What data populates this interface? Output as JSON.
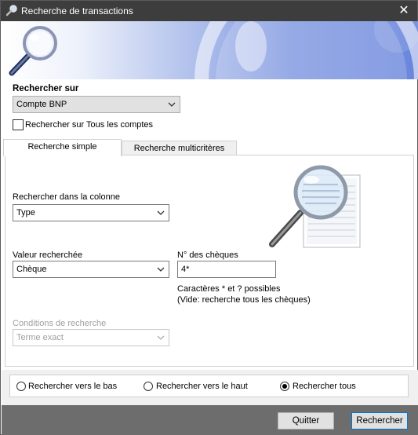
{
  "window": {
    "title": "Recherche de transactions",
    "close_glyph": "✕"
  },
  "search_on": {
    "label": "Rechercher sur",
    "account_value": "Compte BNP",
    "all_accounts_label": "Rechercher sur Tous les comptes",
    "all_accounts_checked": false
  },
  "tabs": [
    {
      "label": "Recherche simple",
      "active": true
    },
    {
      "label": "Recherche multicritères",
      "active": false
    }
  ],
  "simple": {
    "column_label": "Rechercher dans la colonne",
    "column_value": "Type",
    "value_label": "Valeur recherchée",
    "value_value": "Chèque",
    "cheque_label": "N° des chèques",
    "cheque_value": "4*",
    "hint_line1": "Caractères * et ? possibles",
    "hint_line2": "(Vide: recherche tous les chèques)",
    "conditions_label": "Conditions de recherche",
    "conditions_value": "Terme exact"
  },
  "direction": {
    "options": [
      {
        "label": "Rechercher vers le bas",
        "checked": false
      },
      {
        "label": "Rechercher vers le haut",
        "checked": false
      },
      {
        "label": "Rechercher tous",
        "checked": true
      }
    ]
  },
  "buttons": {
    "quit_label": "Quitter",
    "search_label": "Rechercher"
  },
  "colors": {
    "titlebar": "#3d3d3d",
    "banner_accent": "#6a86dc",
    "bottom_bar": "#6d6d6d",
    "default_button_border": "#0078d7"
  },
  "icons": {
    "app": "magnifier-icon",
    "banner": "magnifying-glass-icon",
    "document": "magnified-document-icon"
  }
}
